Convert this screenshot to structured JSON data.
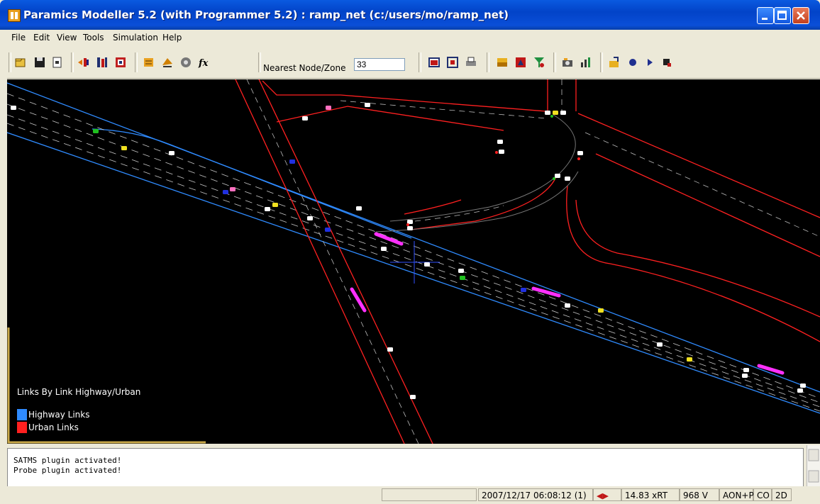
{
  "window": {
    "title": "Paramics Modeller 5.2 (with Programmer 5.2) : ramp_net (c:/users/mo/ramp_net)"
  },
  "menu": [
    "File",
    "Edit",
    "View",
    "Tools",
    "Simulation",
    "Help"
  ],
  "toolbar": {
    "nearest_label": "Nearest Node/Zone",
    "nearest_value": "33"
  },
  "legend": {
    "title": "Links By Link Highway/Urban",
    "items": [
      {
        "label": "Highway Links",
        "color": "#2f8bff"
      },
      {
        "label": "Urban Links",
        "color": "#ff2020"
      }
    ]
  },
  "console": {
    "lines": [
      "SATMS plugin activated!",
      "Probe plugin activated!"
    ]
  },
  "status": {
    "datetime": "2007/12/17 06:08:12 (1)",
    "speed": "14.83 xRT",
    "vehicles": "968 V",
    "mode": "AON+P",
    "co": "CO",
    "view": "2D"
  },
  "colors": {
    "highway": "#2f8bff",
    "urban": "#ff2020",
    "title_bar": "#0a4fd8",
    "canvas": "#000000"
  },
  "icons": [
    "open-icon",
    "save-icon",
    "new-icon",
    "sep",
    "demand-icon",
    "matrix-icon",
    "zones-icon",
    "sep",
    "nodes-icon",
    "links-icon",
    "signals-icon",
    "function-icon",
    "nearest",
    "sep",
    "grid-icon",
    "fit-icon",
    "print-icon",
    "sep",
    "layers-icon",
    "colors-icon",
    "filter-icon",
    "sep",
    "camera-icon",
    "chart-icon",
    "sep",
    "export-icon",
    "record-icon",
    "play-icon",
    "stop-icon"
  ]
}
